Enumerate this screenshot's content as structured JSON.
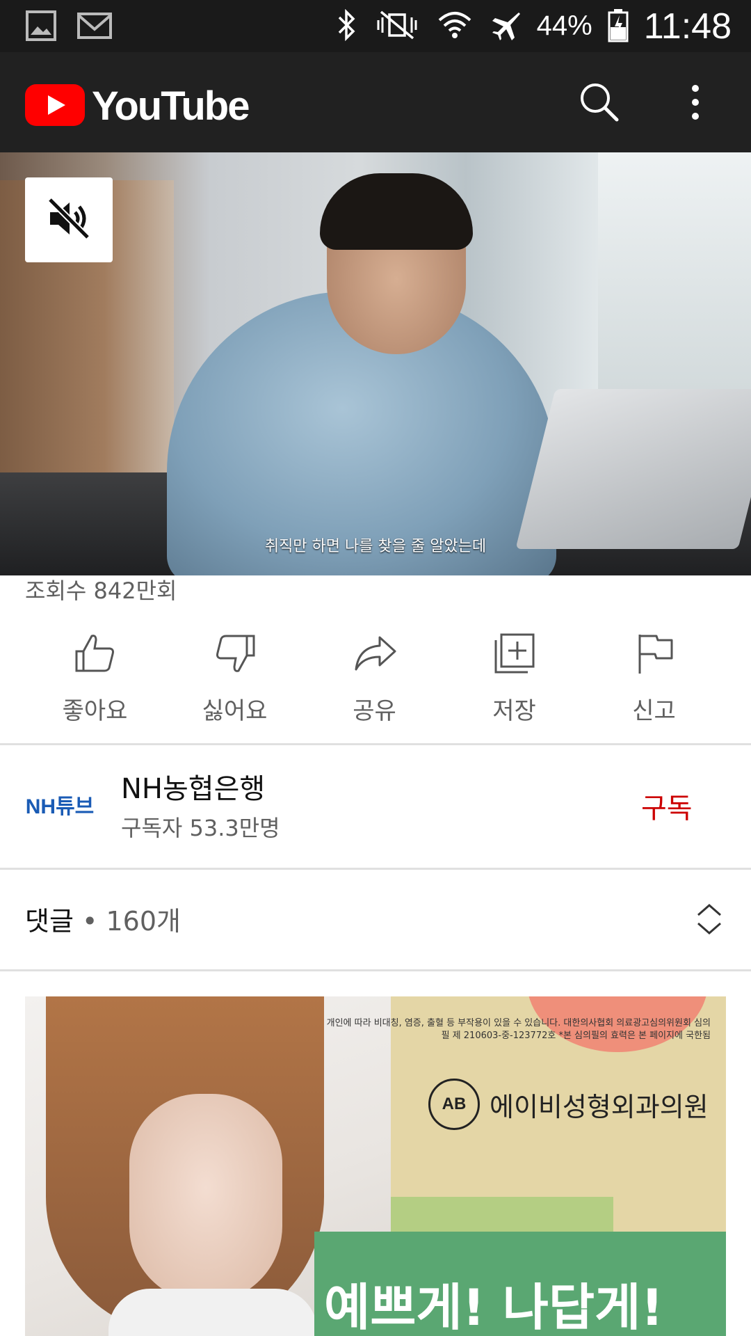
{
  "status_bar": {
    "battery": "44%",
    "time": "11:48"
  },
  "app_bar": {
    "logo_text": "YouTube"
  },
  "video": {
    "subtitle": "취직만 하면 나를 찾을 줄 알았는데"
  },
  "meta": {
    "views": "조회수 842만회"
  },
  "actions": [
    {
      "label": "좋아요",
      "icon": "thumb-up-icon"
    },
    {
      "label": "싫어요",
      "icon": "thumb-down-icon"
    },
    {
      "label": "공유",
      "icon": "share-icon"
    },
    {
      "label": "저장",
      "icon": "add-to-playlist-icon"
    },
    {
      "label": "신고",
      "icon": "flag-icon"
    }
  ],
  "channel": {
    "name": "NH농협은행",
    "subscribers": "구독자 53.3만명",
    "subscribe_label": "구독",
    "avatar_text": "NH튜브"
  },
  "comments": {
    "title": "댓글",
    "count": " • 160개"
  },
  "ad": {
    "disclaimer": "개인에 따라 비대칭, 염증, 출혈 등 부작용이 있을 수 있습니다. 대한의사협회 의료광고심의위원회 심의필 제 210603-중-123772호 *본 심의필의 효력은 본 페이지에 국한됨",
    "clinic_logo": "AB",
    "clinic_name": "에이비성형외과의원",
    "slogan": "예쁘게! 나답게!"
  },
  "colors": {
    "brand_red": "#ff0000",
    "subscribe_red": "#cc0000",
    "app_bar": "#212121",
    "status_bar": "#1a1a1a"
  }
}
